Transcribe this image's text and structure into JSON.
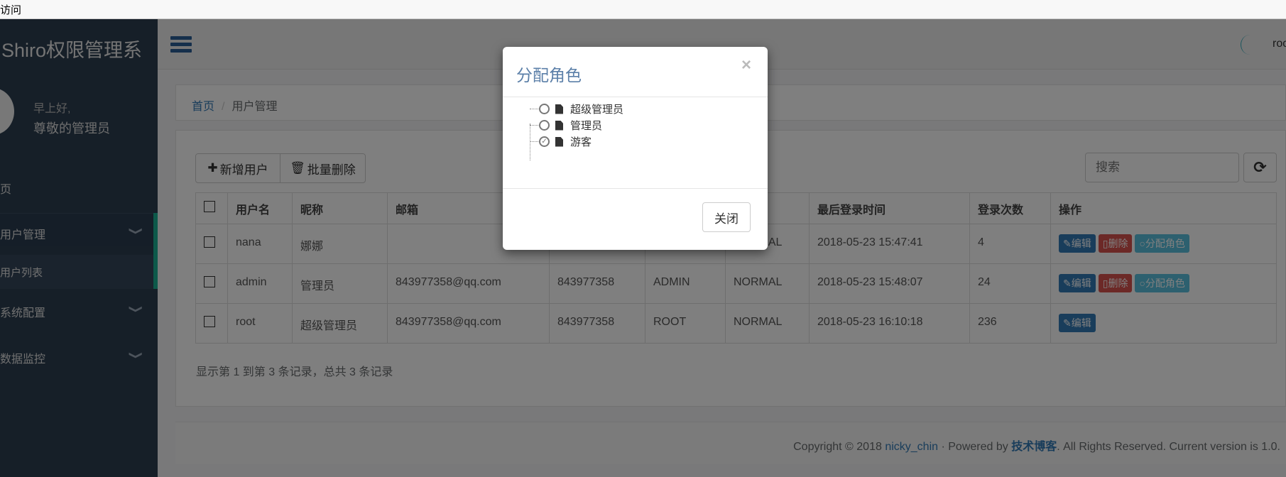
{
  "browser": {
    "tab_text": "访问"
  },
  "sidebar": {
    "title": "Shiro权限管理系",
    "greeting": "早上好,",
    "user_role": "尊敬的管理员",
    "items": [
      {
        "label": "页"
      },
      {
        "label": "用户管理"
      },
      {
        "label": "用户列表"
      },
      {
        "label": "系统配置"
      },
      {
        "label": "数据监控"
      }
    ]
  },
  "header": {
    "user": "roo"
  },
  "breadcrumb": {
    "home": "首页",
    "separator": "/",
    "current": "用户管理"
  },
  "toolbar": {
    "add_label": "新增用户",
    "batch_delete_label": "批量删除",
    "search_placeholder": "搜索"
  },
  "table": {
    "headers": [
      "用户名",
      "昵称",
      "邮箱",
      "",
      "",
      "",
      "最后登录时间",
      "登录次数",
      "操作"
    ],
    "rows": [
      {
        "username": "nana",
        "nickname": "娜娜",
        "email": "",
        "phone": "",
        "role": "",
        "status": "NORMAL",
        "last_login": "2018-05-23 15:47:41",
        "login_count": "4",
        "actions": [
          "编辑",
          "删除",
          "分配角色"
        ]
      },
      {
        "username": "admin",
        "nickname": "管理员",
        "email": "843977358@qq.com",
        "phone": "843977358",
        "role": "ADMIN",
        "status": "NORMAL",
        "last_login": "2018-05-23 15:48:07",
        "login_count": "24",
        "actions": [
          "编辑",
          "删除",
          "分配角色"
        ]
      },
      {
        "username": "root",
        "nickname": "超级管理员",
        "email": "843977358@qq.com",
        "phone": "843977358",
        "role": "ROOT",
        "status": "NORMAL",
        "last_login": "2018-05-23 16:10:18",
        "login_count": "236",
        "actions": [
          "编辑"
        ]
      }
    ]
  },
  "pager": {
    "summary": "显示第 1 到第 3 条记录，总共 3 条记录"
  },
  "footer": {
    "prefix": "Copyright © 2018 ",
    "author": "nicky_chin",
    "mid": " · Powered by ",
    "blog": "技术博客",
    "suffix": ". All Rights Reserved. Current version is 1.0."
  },
  "modal": {
    "title": "分配角色",
    "close_symbol": "×",
    "roles": [
      {
        "label": "超级管理员",
        "checked": false
      },
      {
        "label": "管理员",
        "checked": false
      },
      {
        "label": "游客",
        "checked": true
      }
    ],
    "close_button": "关闭"
  },
  "colors": {
    "primary": "#337ab7",
    "danger": "#d9534f",
    "info": "#5bc0de",
    "sidebar": "#2c3e50",
    "accent": "#1ab394"
  }
}
